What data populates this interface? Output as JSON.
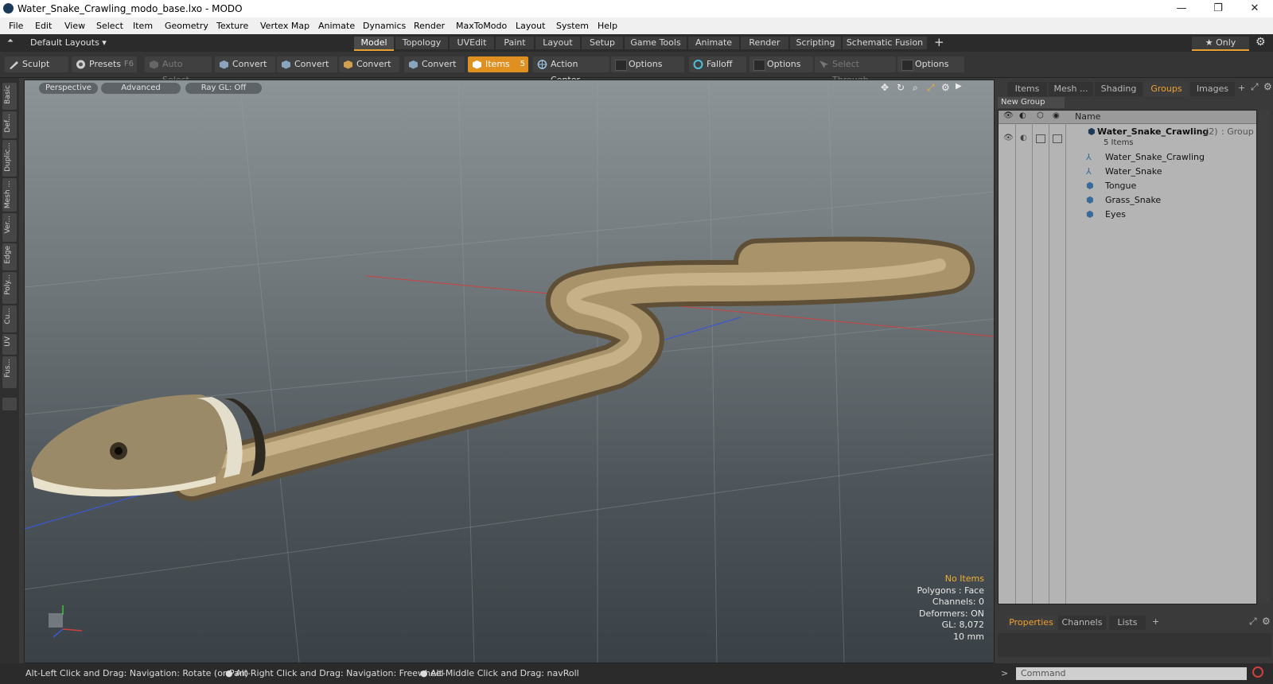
{
  "window": {
    "title": "Water_Snake_Crawling_modo_base.lxo - MODO",
    "minimize": "—",
    "restore": "❐",
    "close": "✕"
  },
  "menu": [
    "File",
    "Edit",
    "View",
    "Select",
    "Item",
    "Geometry",
    "Texture",
    "Vertex Map",
    "Animate",
    "Dynamics",
    "Render",
    "MaxToModo",
    "Layout",
    "System",
    "Help"
  ],
  "layoutbar": {
    "preset": "Default Layouts ▾",
    "tabs": [
      "Model",
      "Topology",
      "UVEdit",
      "Paint",
      "Layout",
      "Setup",
      "Game Tools",
      "Animate",
      "Render",
      "Scripting",
      "Schematic Fusion"
    ],
    "active_tab": "Model",
    "add": "+",
    "only": "★  Only",
    "gear": "⚙"
  },
  "toolbar": {
    "sculpt": "Sculpt",
    "presets": "Presets",
    "presets_key": "F6",
    "auto_select": "Auto Select",
    "convert": "Convert",
    "items": "Items",
    "items_key": "5",
    "action_center": "Action Center",
    "options": "Options",
    "falloff": "Falloff",
    "select_through": "Select Through"
  },
  "lefttabs": [
    "Basic",
    "Def...",
    "Duplic...",
    "Mesh ...",
    "Ver...",
    "Edge",
    "Poly...",
    "Cu...",
    "UV",
    "Fus..."
  ],
  "viewport": {
    "view": "Perspective",
    "shading": "Advanced",
    "raygl": "Ray GL: Off",
    "hud": {
      "selection": "No Items",
      "polygons": "Polygons : Face",
      "channels": "Channels: 0",
      "deformers": "Deformers: ON",
      "gl": "GL: 8,072",
      "size": "10 mm"
    }
  },
  "rightpanel": {
    "tabs": [
      "Items",
      "Mesh ...",
      "Shading",
      "Groups",
      "Images"
    ],
    "active_tab": "Groups",
    "add": "+",
    "new_group": "New Group",
    "column_name": "Name",
    "group": {
      "name": "Water_Snake_Crawling",
      "count": "(2)",
      "kind": ": Group",
      "items_label": "5 Items"
    },
    "children": [
      {
        "name": "Water_Snake_Crawling",
        "icon": "locator-icon"
      },
      {
        "name": "Water_Snake",
        "icon": "locator-icon"
      },
      {
        "name": "Tongue",
        "icon": "mesh-icon"
      },
      {
        "name": "Grass_Snake",
        "icon": "mesh-icon"
      },
      {
        "name": "Eyes",
        "icon": "mesh-icon"
      }
    ],
    "bottom_tabs": [
      "Properties",
      "Channels",
      "Lists"
    ],
    "bottom_active": "Properties"
  },
  "status": {
    "hint1": "Alt-Left Click and Drag: Navigation: Rotate (or Pan)",
    "hint2": "Alt-Right Click and Drag: Navigation: Freewheel",
    "hint3": "Alt-Middle Click and Drag: navRoll",
    "prompt": ">",
    "command_placeholder": "Command"
  },
  "colors": {
    "accent": "#e8a030",
    "items_button": "#e09020",
    "viewport_top": "#8d9498",
    "viewport_bottom": "#3a4146"
  }
}
